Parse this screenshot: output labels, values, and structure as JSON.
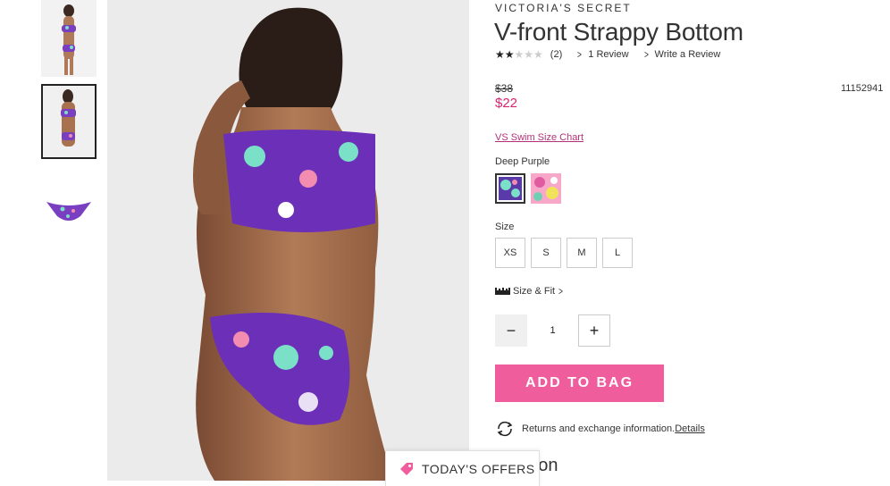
{
  "brand": "VICTORIA'S SECRET",
  "product": {
    "title": "V-front Strappy Bottom",
    "rating_stars": "★★★★★",
    "rating_value": 2,
    "rating_count": "(2)",
    "reviews_link": "1 Review",
    "write_review_link": "Write a Review",
    "original_price": "$38",
    "sale_price": "$22",
    "sku": "11152941"
  },
  "size_chart_link": "VS Swim Size Chart",
  "color": {
    "selected_label": "Deep Purple",
    "swatches": [
      "deep-purple-floral",
      "pink-floral"
    ]
  },
  "size": {
    "label": "Size",
    "options": [
      "XS",
      "S",
      "M",
      "L"
    ]
  },
  "size_fit_link": "Size & Fit",
  "quantity": {
    "minus": "−",
    "value": "1",
    "plus": "+"
  },
  "add_to_bag": "ADD TO BAG",
  "returns": {
    "text": "Returns and exchange information.",
    "link": "Details"
  },
  "description_heading": "ription",
  "offers_tab": "TODAY'S OFFERS",
  "colors": {
    "accent_pink": "#ef5d9c",
    "sale_red": "#d6246e",
    "link_magenta": "#b2327a"
  },
  "icons": [
    "chevron-right-icon",
    "ruler-icon",
    "refresh-icon",
    "tag-icon"
  ]
}
